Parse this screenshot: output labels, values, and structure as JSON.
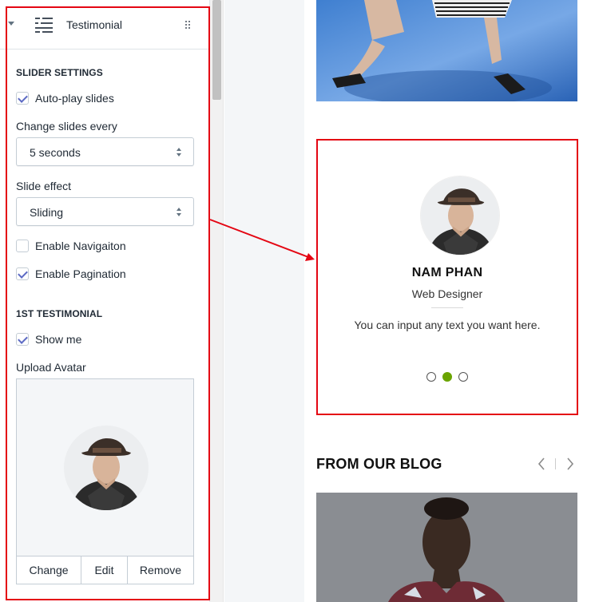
{
  "panel": {
    "header": {
      "title": "Testimonial",
      "icon": "text-align-icon"
    },
    "slider_settings": {
      "title": "SLIDER SETTINGS",
      "autoplay": {
        "label": "Auto-play slides",
        "checked": true
      },
      "change_every": {
        "label": "Change slides every",
        "value": "5 seconds"
      },
      "slide_effect": {
        "label": "Slide effect",
        "value": "Sliding"
      },
      "navigation": {
        "label": "Enable Navigaiton",
        "checked": false
      },
      "pagination": {
        "label": "Enable Pagination",
        "checked": true
      }
    },
    "testimonial_1": {
      "title": "1ST TESTIMONIAL",
      "show_me": {
        "label": "Show me",
        "checked": true
      },
      "upload_avatar_label": "Upload Avatar",
      "buttons": {
        "change": "Change",
        "edit": "Edit",
        "remove": "Remove"
      }
    }
  },
  "preview": {
    "testimonial": {
      "name": "NAM PHAN",
      "role": "Web Designer",
      "text": "You can input any text you want here.",
      "pagination": {
        "count": 3,
        "active": 2
      }
    },
    "blog": {
      "title": "FROM OUR BLOG"
    }
  },
  "colors": {
    "highlight": "#e40613",
    "checkbox_accent": "#5c6ac4",
    "active_dot": "#6aa400"
  }
}
